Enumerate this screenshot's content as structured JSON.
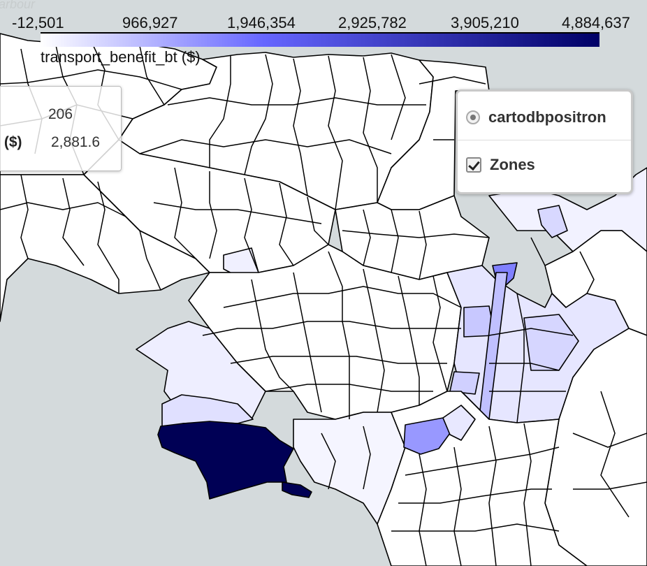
{
  "colorbar": {
    "ticks": [
      "-12,501",
      "966,927",
      "1,946,354",
      "2,925,782",
      "3,905,210",
      "4,884,637"
    ],
    "label": "transport_benefit_bt ($)",
    "color_min": "#ffffff",
    "color_max": "#000066",
    "mid_color": "#6666ff"
  },
  "basemap_label": "arbour",
  "tooltip": {
    "value1": "206",
    "label2": "t ($)",
    "value2": "2,881.6"
  },
  "layer_control": {
    "base_layer": "cartodbpositron",
    "overlay": "Zones",
    "overlay_checked": true
  },
  "map": {
    "water_color": "#d4dadc",
    "land_zone_color": "#ffffff",
    "highlight_zone_color": "#000055"
  }
}
